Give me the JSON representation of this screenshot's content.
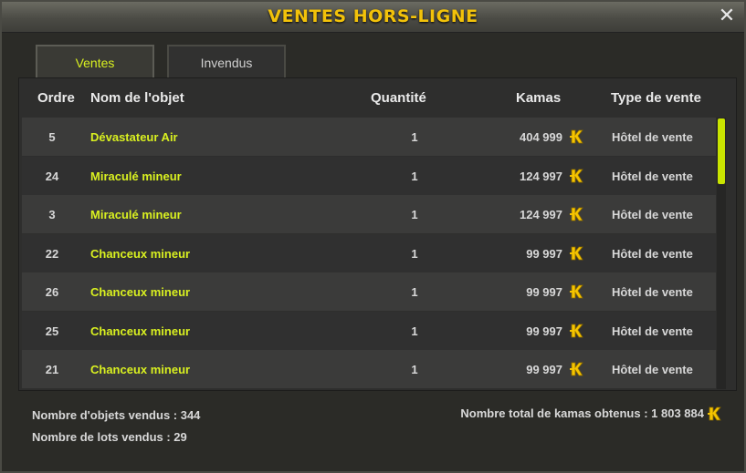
{
  "window": {
    "title": "VENTES HORS-LIGNE",
    "close_label": "✕"
  },
  "tabs": [
    {
      "label": "Ventes",
      "active": true
    },
    {
      "label": "Invendus",
      "active": false
    }
  ],
  "table": {
    "headers": {
      "ordre": "Ordre",
      "nom": "Nom de l'objet",
      "quantite": "Quantité",
      "kamas": "Kamas",
      "type": "Type de vente"
    },
    "rows": [
      {
        "ordre": "5",
        "nom": "Dévastateur Air",
        "quantite": "1",
        "kamas": "404 999",
        "type": "Hôtel de vente"
      },
      {
        "ordre": "24",
        "nom": "Miraculé mineur",
        "quantite": "1",
        "kamas": "124 997",
        "type": "Hôtel de vente"
      },
      {
        "ordre": "3",
        "nom": "Miraculé mineur",
        "quantite": "1",
        "kamas": "124 997",
        "type": "Hôtel de vente"
      },
      {
        "ordre": "22",
        "nom": "Chanceux mineur",
        "quantite": "1",
        "kamas": "99 997",
        "type": "Hôtel de vente"
      },
      {
        "ordre": "26",
        "nom": "Chanceux mineur",
        "quantite": "1",
        "kamas": "99 997",
        "type": "Hôtel de vente"
      },
      {
        "ordre": "25",
        "nom": "Chanceux mineur",
        "quantite": "1",
        "kamas": "99 997",
        "type": "Hôtel de vente"
      },
      {
        "ordre": "21",
        "nom": "Chanceux mineur",
        "quantite": "1",
        "kamas": "99 997",
        "type": "Hôtel de vente"
      }
    ]
  },
  "footer": {
    "objets_vendus": "Nombre d'objets vendus : 344",
    "lots_vendus": "Nombre de lots vendus : 29",
    "total_kamas": "Nombre total de kamas obtenus : 1 803 884"
  },
  "colors": {
    "title": "#f2c20a",
    "item_name": "#d9f020",
    "scroll_thumb": "#c9e400",
    "kama_icon": "#f5c400"
  },
  "icons": {
    "kama": "kama-icon",
    "close": "close-icon"
  }
}
